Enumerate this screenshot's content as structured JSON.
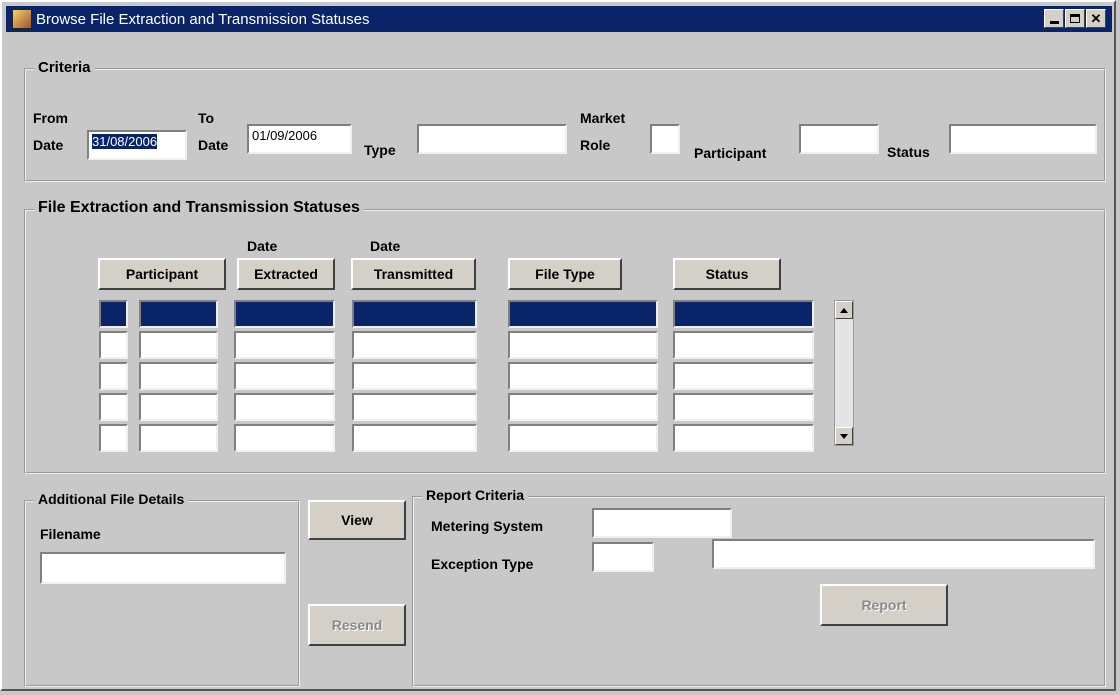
{
  "window": {
    "title": "Browse File Extraction and Transmission Statuses"
  },
  "criteria": {
    "legend": "Criteria",
    "from_label_1": "From",
    "from_label_2": "Date",
    "from_value": "31/08/2006",
    "to_label_1": "To",
    "to_label_2": "Date",
    "to_value": "01/09/2006",
    "type_label": "Type",
    "type_value": "",
    "market_label_1": "Market",
    "market_label_2": "Role",
    "market_value": "",
    "participant_label": "Participant",
    "participant_value": "",
    "status_label": "Status",
    "status_value": ""
  },
  "statuses": {
    "legend": "File Extraction and Transmission Statuses",
    "columns": {
      "participant": "Participant",
      "extracted_top": "Date",
      "extracted": "Extracted",
      "transmitted_top": "Date",
      "transmitted": "Transmitted",
      "file_type": "File Type",
      "status": "Status"
    },
    "row_count": 5
  },
  "additional": {
    "legend": "Additional File Details",
    "filename_label": "Filename",
    "filename_value": ""
  },
  "actions": {
    "view": "View",
    "resend": "Resend"
  },
  "report": {
    "legend": "Report Criteria",
    "metering_label": "Metering System",
    "metering_value": "",
    "exception_label": "Exception Type",
    "exception_code": "",
    "exception_desc": "",
    "report_button": "Report"
  },
  "colors": {
    "titlebar": "#0a246a",
    "selection": "#0a246a",
    "window_bg": "#c8c8c8"
  }
}
